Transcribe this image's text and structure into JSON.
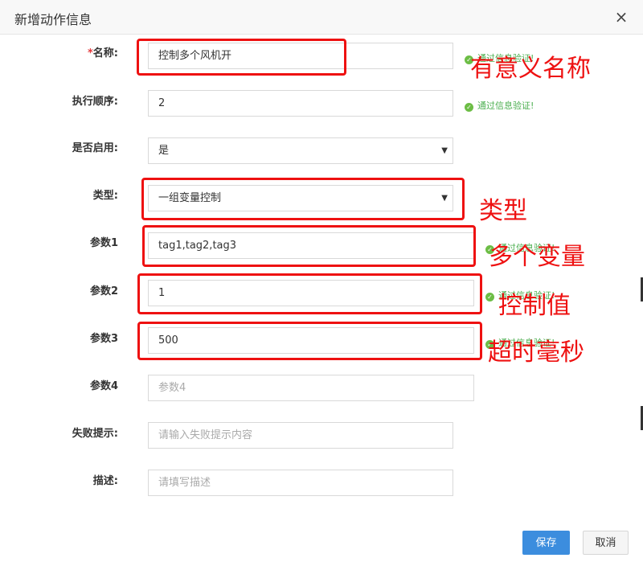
{
  "dialog": {
    "title": "新增动作信息",
    "close_label": "×"
  },
  "form": {
    "required_mark": "*",
    "name": {
      "label": "名称:",
      "value": "控制多个风机开",
      "validation": "通过信息验证!"
    },
    "order": {
      "label": "执行顺序:",
      "value": "2",
      "validation": "通过信息验证!"
    },
    "enabled": {
      "label": "是否启用:",
      "value": "是"
    },
    "type": {
      "label": "类型:",
      "value": "一组变量控制"
    },
    "param1": {
      "label": "参数1",
      "value": "tag1,tag2,tag3",
      "validation": "通过信息验证!"
    },
    "param2": {
      "label": "参数2",
      "value": "1",
      "validation": "通过信息验证!"
    },
    "param3": {
      "label": "参数3",
      "value": "500",
      "validation": "通过信息验证!"
    },
    "param4": {
      "label": "参数4",
      "placeholder": "参数4"
    },
    "failure_hint": {
      "label": "失败提示:",
      "placeholder": "请输入失败提示内容"
    },
    "description": {
      "label": "描述:",
      "placeholder": "请填写描述"
    }
  },
  "annotations": {
    "name": "有意义名称",
    "type": "类型",
    "param1": "多个变量",
    "param2": "控制值",
    "param3": "超时毫秒"
  },
  "buttons": {
    "save": "保存",
    "cancel": "取消"
  },
  "colors": {
    "annotation_red": "#ee1111",
    "validation_green": "#4caf50",
    "primary_button": "#3c8dde"
  }
}
